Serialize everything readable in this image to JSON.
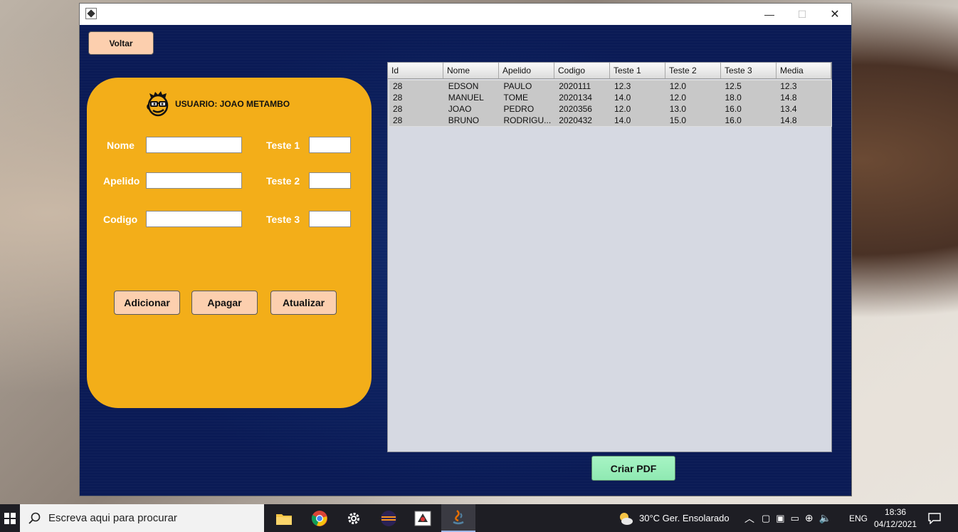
{
  "window": {
    "controls": {
      "minimize": "—",
      "maximize": "☐",
      "close": "✕"
    }
  },
  "toolbar": {
    "back_label": "Voltar"
  },
  "form": {
    "user_label": "USUARIO: JOAO METAMBO",
    "fields": {
      "nome": {
        "label": "Nome",
        "value": ""
      },
      "apelido": {
        "label": "Apelido",
        "value": ""
      },
      "codigo": {
        "label": "Codigo",
        "value": ""
      },
      "teste1": {
        "label": "Teste 1",
        "value": ""
      },
      "teste2": {
        "label": "Teste 2",
        "value": ""
      },
      "teste3": {
        "label": "Teste 3",
        "value": ""
      }
    },
    "buttons": {
      "add": "Adicionar",
      "delete": "Apagar",
      "update": "Atualizar"
    }
  },
  "table": {
    "headers": [
      "Id",
      "Nome",
      "Apelido",
      "Codigo",
      "Teste 1",
      "Teste 2",
      "Teste 3",
      "Media"
    ],
    "rows": [
      [
        "28",
        "EDSON",
        "PAULO",
        "2020111",
        "12.3",
        "12.0",
        "12.5",
        "12.3"
      ],
      [
        "28",
        "MANUEL",
        "TOME",
        "2020134",
        "14.0",
        "12.0",
        "18.0",
        "14.8"
      ],
      [
        "28",
        "JOAO",
        "PEDRO",
        "2020356",
        "12.0",
        "13.0",
        "16.0",
        "13.4"
      ],
      [
        "28",
        "BRUNO",
        "RODRIGU...",
        "2020432",
        "14.0",
        "15.0",
        "16.0",
        "14.8"
      ]
    ]
  },
  "pdf_button": "Criar PDF",
  "taskbar": {
    "search_placeholder": "Escreva aqui para procurar",
    "weather": "30°C  Ger. Ensolarado",
    "lang": "ENG",
    "time": "18:36",
    "date": "04/12/2021"
  },
  "colors": {
    "panel": "#f3ae19",
    "client_bg": "#0a1a55",
    "button_peach": "#fccfae",
    "pdf_green": "#a7f4c4"
  }
}
